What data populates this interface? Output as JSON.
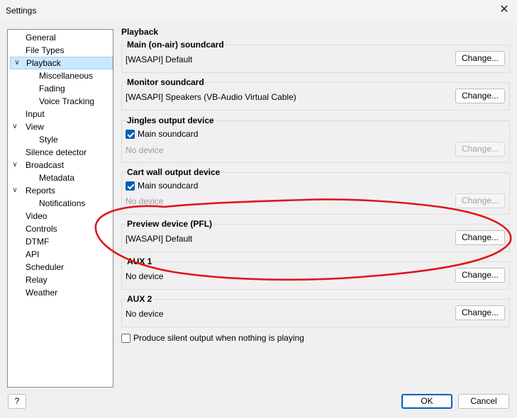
{
  "window": {
    "title": "Settings",
    "close_glyph": "✕"
  },
  "tree": {
    "items": [
      {
        "label": "General"
      },
      {
        "label": "File Types"
      },
      {
        "label": "Playback",
        "expanded": true,
        "selected": true
      },
      {
        "label": "Miscellaneous"
      },
      {
        "label": "Fading"
      },
      {
        "label": "Voice Tracking"
      },
      {
        "label": "Input"
      },
      {
        "label": "View",
        "expanded": true
      },
      {
        "label": "Style"
      },
      {
        "label": "Silence detector"
      },
      {
        "label": "Broadcast",
        "expanded": true
      },
      {
        "label": "Metadata"
      },
      {
        "label": "Reports",
        "expanded": true
      },
      {
        "label": "Notifications"
      },
      {
        "label": "Video"
      },
      {
        "label": "Controls"
      },
      {
        "label": "DTMF"
      },
      {
        "label": "API"
      },
      {
        "label": "Scheduler"
      },
      {
        "label": "Relay"
      },
      {
        "label": "Weather"
      }
    ]
  },
  "panel": {
    "title": "Playback",
    "groups": [
      {
        "title": "Main (on-air) soundcard",
        "value": "[WASAPI] Default",
        "button": "Change..."
      },
      {
        "title": "Monitor soundcard",
        "value": "[WASAPI] Speakers (VB-Audio Virtual Cable)",
        "button": "Change..."
      },
      {
        "title": "Jingles output device",
        "checkbox": "Main soundcard",
        "checked": true,
        "value": "No device",
        "button": "Change..."
      },
      {
        "title": "Cart wall output device",
        "checkbox": "Main soundcard",
        "checked": true,
        "value": "No device",
        "button": "Change..."
      },
      {
        "title": "Preview device (PFL)",
        "value": "[WASAPI] Default",
        "button": "Change..."
      },
      {
        "title": "AUX 1",
        "value": "No device",
        "button": "Change..."
      },
      {
        "title": "AUX 2",
        "value": "No device",
        "button": "Change..."
      }
    ],
    "silent_output": {
      "label": "Produce silent output when nothing is playing",
      "checked": false
    }
  },
  "footer": {
    "help": "?",
    "ok": "OK",
    "cancel": "Cancel"
  },
  "colors": {
    "annotation": "#e0161b",
    "accent": "#005fb8",
    "selection": "#cce8ff"
  }
}
